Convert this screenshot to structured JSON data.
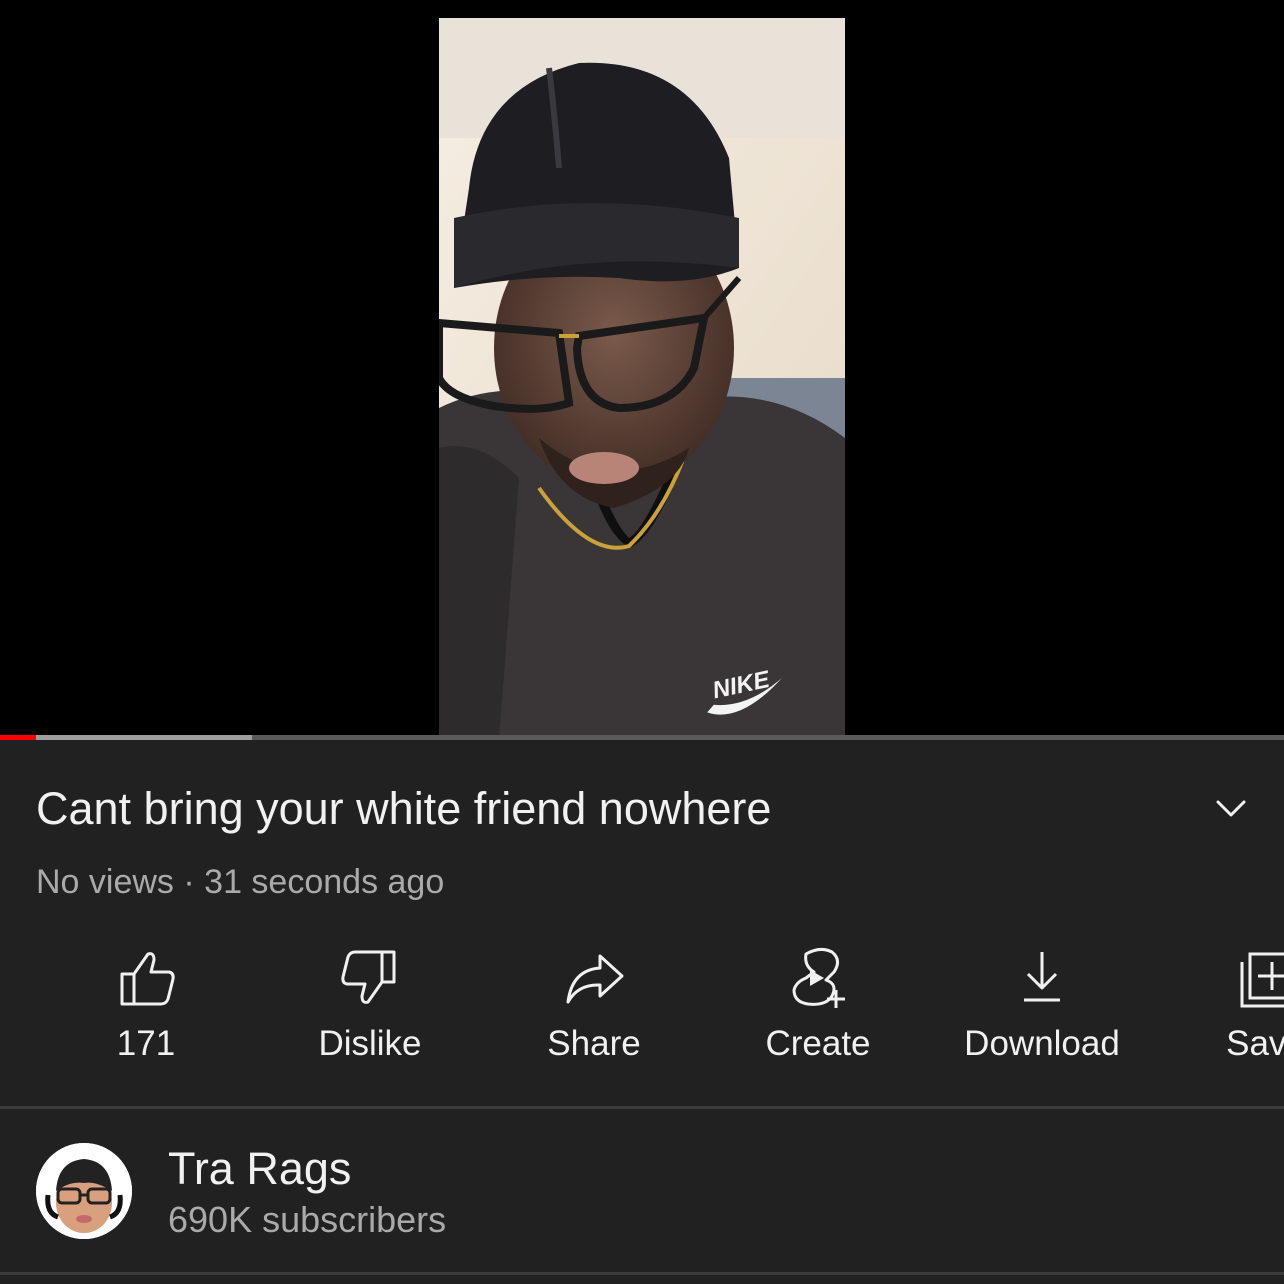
{
  "colors": {
    "background": "#212121",
    "progress_played": "#ff0000",
    "progress_buffer": "#9e9e9e",
    "secondary_text": "#aaaaaa"
  },
  "player": {
    "progress_played": 0.028,
    "progress_buffered": 0.196,
    "frame_logo_text": "NIKE"
  },
  "video": {
    "title": "Cant bring your white friend nowhere",
    "views": "No views",
    "separator": "·",
    "age": "31 seconds ago"
  },
  "actions": [
    {
      "label": "171",
      "icon": "thumbs-up-icon"
    },
    {
      "label": "Dislike",
      "icon": "thumbs-down-icon"
    },
    {
      "label": "Share",
      "icon": "share-icon"
    },
    {
      "label": "Create",
      "icon": "create-icon"
    },
    {
      "label": "Download",
      "icon": "download-icon"
    },
    {
      "label": "Save",
      "icon": "save-playlist-icon"
    }
  ],
  "channel": {
    "name": "Tra Rags",
    "subscribers": "690K subscribers"
  }
}
